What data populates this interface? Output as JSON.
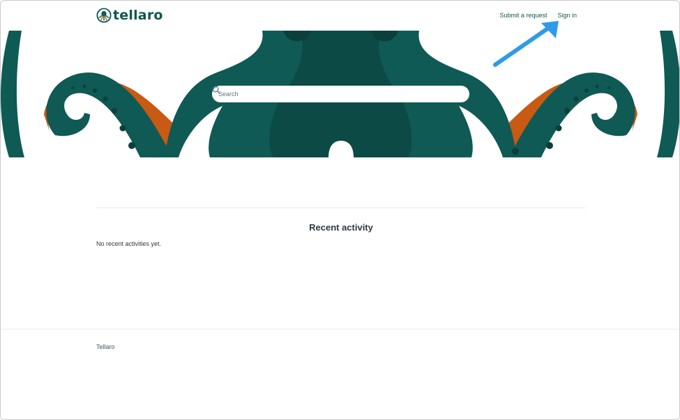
{
  "brand": {
    "name": "tellaro",
    "primary_color": "#0f5a55",
    "accent_color": "#c85a14",
    "logo_icon": "octopus-icon"
  },
  "nav": {
    "submit_request": "Submit a request",
    "sign_in": "Sign in"
  },
  "search": {
    "placeholder": "Search",
    "value": "",
    "icon": "search-icon"
  },
  "annotation": {
    "icon": "arrow-pointer-icon",
    "color": "#2f9be8"
  },
  "main": {
    "recent_activity_title": "Recent activity",
    "empty_message": "No recent activities yet."
  },
  "footer": {
    "brand_text": "Tellaro"
  }
}
